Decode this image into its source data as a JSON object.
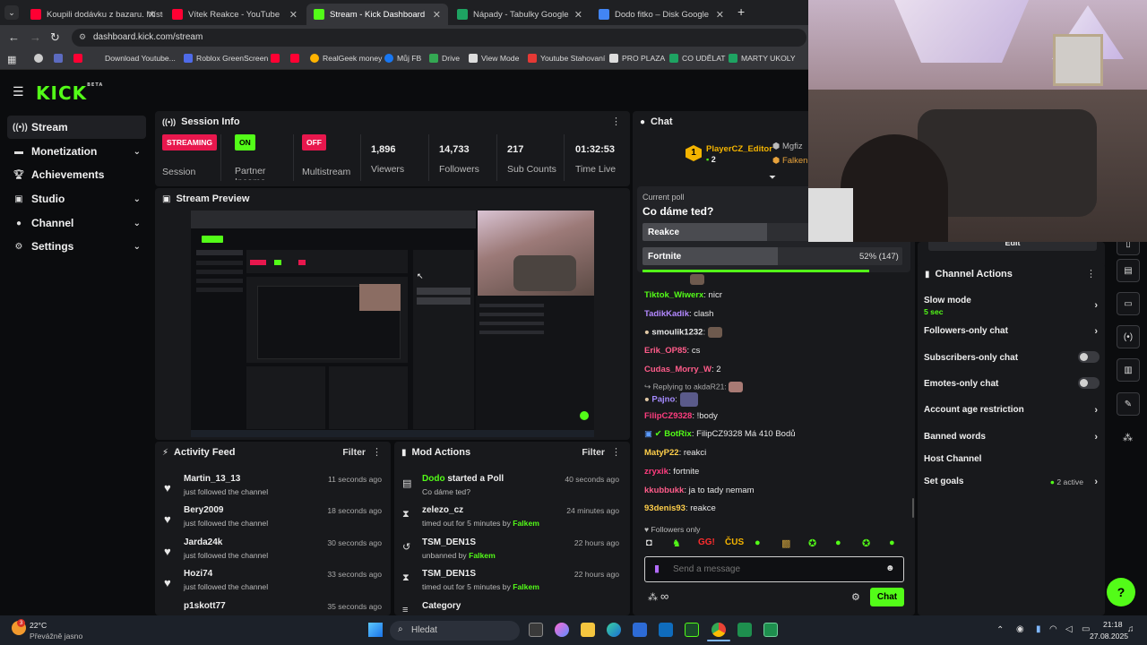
{
  "browser": {
    "tabs": [
      {
        "label": "Koupili dodávku z bazaru. Místo",
        "color": "#ff0033"
      },
      {
        "label": "Vítek Reakce - YouTube",
        "color": "#ff0033"
      },
      {
        "label": "Stream - Kick Dashboard",
        "color": "#53fc18"
      },
      {
        "label": "Nápady - Tabulky Google",
        "color": "#1ea362"
      },
      {
        "label": "Dodo fitko – Disk Google",
        "color": "#4285f4"
      }
    ],
    "url": "dashboard.kick.com/stream",
    "bookmarks": [
      "Download Youtube...",
      "Roblox GreenScreen",
      "RealGeek money",
      "Můj FB",
      "Drive",
      "View Mode",
      "Youtube Stahovaní",
      "PRO PLAZA",
      "CO UDĚLAT",
      "MARTY UKOLY"
    ]
  },
  "sidebar": {
    "logo": "KICK",
    "logo_sup": "BETA",
    "items": [
      {
        "label": "Stream",
        "icon": "broadcast-icon"
      },
      {
        "label": "Monetization",
        "icon": "money-icon"
      },
      {
        "label": "Achievements",
        "icon": "trophy-icon"
      },
      {
        "label": "Studio",
        "icon": "studio-icon"
      },
      {
        "label": "Channel",
        "icon": "user-icon"
      },
      {
        "label": "Settings",
        "icon": "gear-icon"
      }
    ]
  },
  "session": {
    "title": "Session Info",
    "streaming": {
      "badge": "STREAMING",
      "label": "Session"
    },
    "partner": {
      "badge": "ON",
      "label": "Partner Income"
    },
    "multistream": {
      "badge": "OFF",
      "label": "Multistream"
    },
    "viewers": {
      "value": "1,896",
      "label": "Viewers"
    },
    "followers": {
      "value": "14,733",
      "label": "Followers"
    },
    "subs": {
      "value": "217",
      "label": "Sub Counts"
    },
    "time": {
      "value": "01:32:53",
      "label": "Time Live"
    }
  },
  "preview": {
    "title": "Stream Preview"
  },
  "activity": {
    "title": "Activity Feed",
    "filter": "Filter",
    "rows": [
      {
        "name": "Martin_13_13",
        "sub": "just followed the channel",
        "time": "11 seconds ago"
      },
      {
        "name": "Bery2009",
        "sub": "just followed the channel",
        "time": "18 seconds ago"
      },
      {
        "name": "Jarda24k",
        "sub": "just followed the channel",
        "time": "30 seconds ago"
      },
      {
        "name": "Hozi74",
        "sub": "just followed the channel",
        "time": "33 seconds ago"
      },
      {
        "name": "p1skott77",
        "sub": "",
        "time": "35 seconds ago"
      }
    ]
  },
  "mod": {
    "title": "Mod Actions",
    "filter": "Filter",
    "rows": [
      {
        "icon": "poll-icon",
        "name": "Dodo",
        "action": " started a Poll",
        "sub": "Co dáme ted?",
        "by": "",
        "time": "40 seconds ago"
      },
      {
        "icon": "hourglass-icon",
        "name": "zelezo_cz",
        "action": "",
        "sub": "timed out for 5 minutes by ",
        "by": "Falkem",
        "time": "24 minutes ago"
      },
      {
        "icon": "undo-icon",
        "name": "TSM_DEN1S",
        "action": "",
        "sub": "unbanned by ",
        "by": "Falkem",
        "time": "22 hours ago"
      },
      {
        "icon": "hourglass-icon",
        "name": "TSM_DEN1S",
        "action": "",
        "sub": "timed out for 5 minutes by ",
        "by": "Falkem",
        "time": "22 hours ago"
      },
      {
        "icon": "list-icon",
        "name": "Category",
        "action": "",
        "sub": "",
        "by": "",
        "time": ""
      }
    ]
  },
  "chat": {
    "title": "Chat",
    "top_gifter": {
      "rank": "1",
      "name": "PlayerCZ_Editor",
      "count": "2"
    },
    "other_gifters": [
      "Mgfiz",
      "Falken"
    ],
    "poll": {
      "label": "Current poll",
      "question": "Co dáme ted?",
      "options": [
        {
          "label": "Reakce",
          "result": "",
          "pct": 48
        },
        {
          "label": "Fortnite",
          "result": "52% (147)",
          "pct": 52
        }
      ]
    },
    "messages": [
      {
        "user": "Tiktok_Wiwerx",
        "color": "#53fc18",
        "text": ": nicr"
      },
      {
        "user": "TadikKadik",
        "color": "#b388ff",
        "text": ": clash"
      },
      {
        "user": "smoulik1232",
        "color": "#f0f0f0",
        "text": ":"
      },
      {
        "user": "Erik_OP85",
        "color": "#ff5c8a",
        "text": ": cs"
      },
      {
        "user": "Cudas_Morry_W",
        "color": "#ff5c8a",
        "text": ": 2"
      },
      {
        "user": "Pajno",
        "color": "#a58bff",
        "text": ":"
      },
      {
        "user": "FilipCZ9328",
        "color": "#ff3d7f",
        "text": ": !body"
      },
      {
        "user": "BotRix",
        "color": "#53fc18",
        "text": ": FilipCZ9328 Má 410 Bodů"
      },
      {
        "user": "MatyP22",
        "color": "#ffcf4a",
        "text": ": reakci"
      },
      {
        "user": "zryxik",
        "color": "#ff3d7f",
        "text": ": fortnite"
      },
      {
        "user": "kkubbukk",
        "color": "#ff5c8a",
        "text": ": ja to tady nemam"
      },
      {
        "user": "93denis93",
        "color": "#ffcf4a",
        "text": ": reakce"
      }
    ],
    "reply_note": "Replying to akdaR21:",
    "followers_only": "Followers only",
    "placeholder": "Send a message",
    "send_label": "Chat",
    "infinity": "∞"
  },
  "channel_actions": {
    "title": "Channel Actions",
    "edit": "Edit",
    "rows": [
      {
        "label": "Slow mode",
        "sub": "5 sec"
      },
      {
        "label": "Followers-only chat",
        "sub": ""
      },
      {
        "label": "Subscribers-only chat",
        "sub": ""
      },
      {
        "label": "Emotes-only chat",
        "sub": ""
      },
      {
        "label": "Account age restriction",
        "sub": ""
      },
      {
        "label": "Banned words",
        "sub": ""
      },
      {
        "label": "Host Channel",
        "sub": ""
      },
      {
        "label": "Set goals",
        "sub": "2 active"
      }
    ]
  },
  "taskbar": {
    "weather_temp": "22°C",
    "weather_desc": "Převážně jasno",
    "weather_badge": "3",
    "search": "Hledat",
    "time": "21:18",
    "date": "27.08.2025"
  },
  "colors": {
    "accent": "#53fc18",
    "live": "#e8174d",
    "panel": "#18191c"
  }
}
